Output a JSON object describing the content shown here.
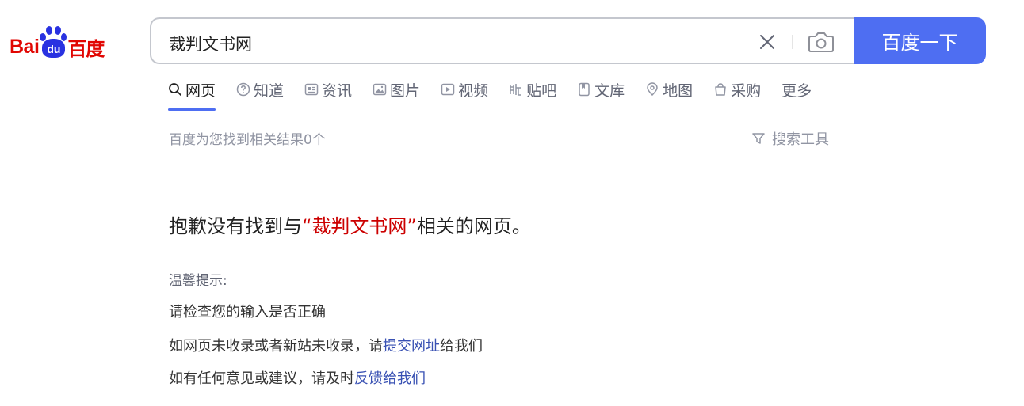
{
  "logo": {
    "bai": "Bai",
    "du": "du",
    "cn": "百度"
  },
  "search": {
    "query": "裁判文书网",
    "button_label": "百度一下"
  },
  "tabs": [
    {
      "label": "网页",
      "icon": "search-icon",
      "active": true
    },
    {
      "label": "知道",
      "icon": "question-icon",
      "active": false
    },
    {
      "label": "资讯",
      "icon": "news-icon",
      "active": false
    },
    {
      "label": "图片",
      "icon": "image-icon",
      "active": false
    },
    {
      "label": "视频",
      "icon": "video-icon",
      "active": false
    },
    {
      "label": "贴吧",
      "icon": "tieba-icon",
      "active": false
    },
    {
      "label": "文库",
      "icon": "document-icon",
      "active": false
    },
    {
      "label": "地图",
      "icon": "map-icon",
      "active": false
    },
    {
      "label": "采购",
      "icon": "shopping-icon",
      "active": false
    },
    {
      "label": "更多",
      "icon": "",
      "active": false
    }
  ],
  "results": {
    "count_text": "百度为您找到相关结果0个",
    "search_tools": "搜索工具"
  },
  "not_found": {
    "prefix": "抱歉没有找到与",
    "open_quote": "“",
    "query": "裁判文书网",
    "close_quote": "”",
    "suffix": "相关的网页。"
  },
  "tips": {
    "title": "温馨提示:",
    "line1": "请检查您的输入是否正确",
    "line2_text": "如网页未收录或者新站未收录，请",
    "line2_link": "提交网址",
    "line2_suffix": "给我们",
    "line3_text": "如有任何意见或建议，请及时",
    "line3_link": "反馈给我们"
  },
  "colors": {
    "accent": "#4e6ef2",
    "logo_red": "#e10602",
    "logo_blue": "#2932e1",
    "query_red": "#cc0000",
    "link_blue": "#3951b3"
  }
}
